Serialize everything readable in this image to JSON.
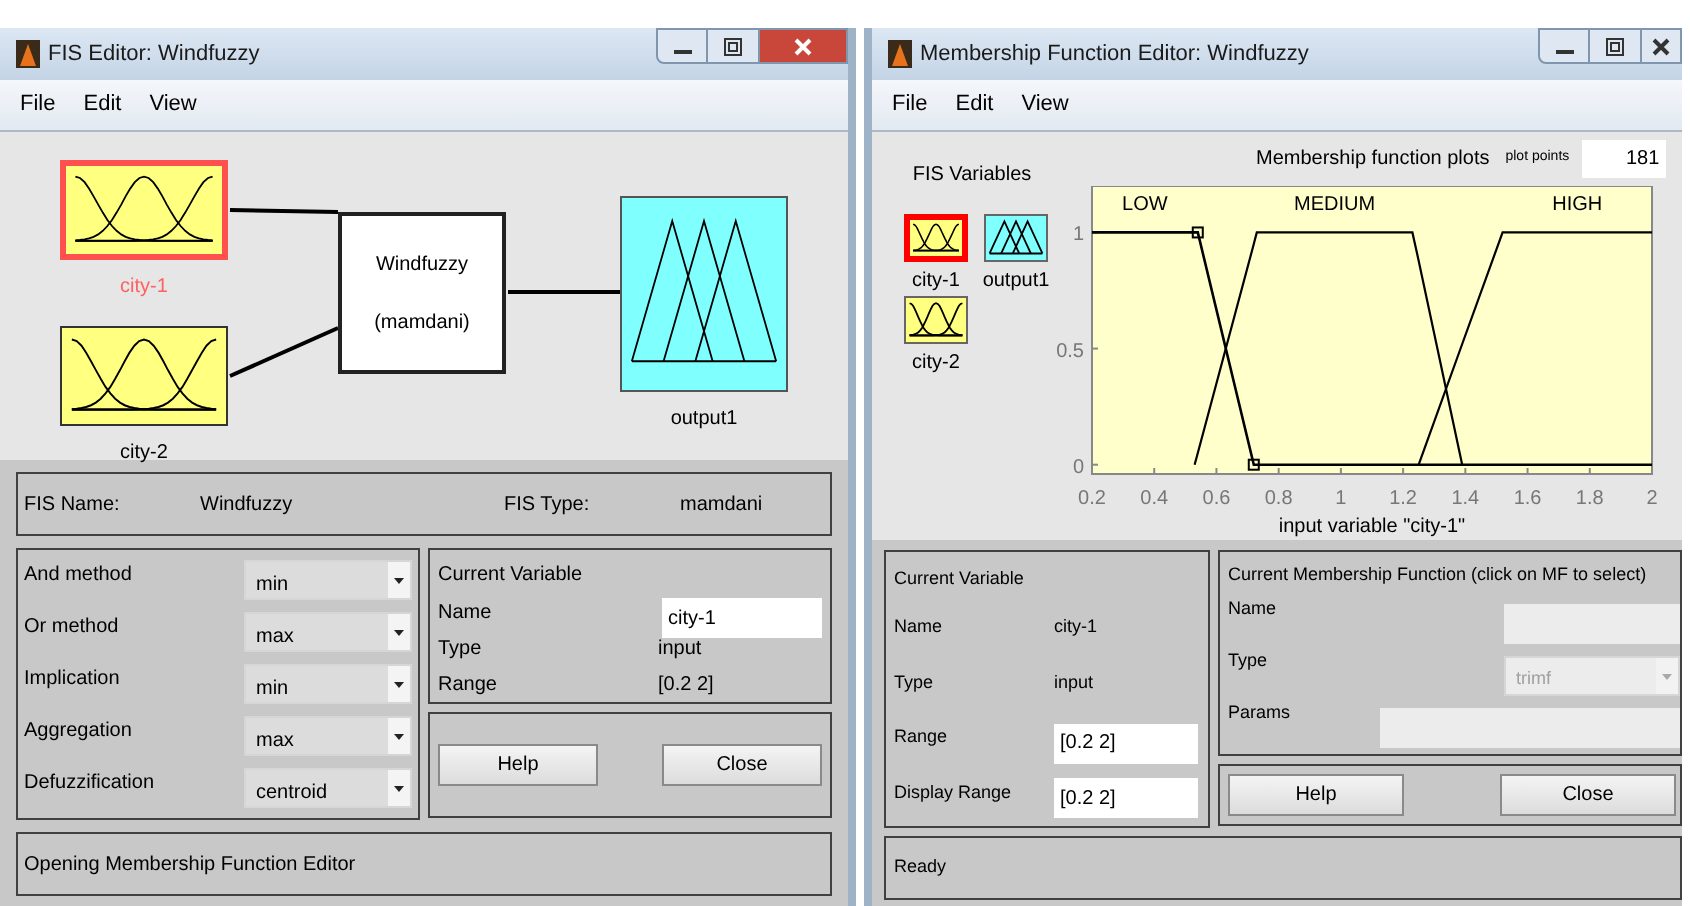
{
  "fis_editor": {
    "window": {
      "title": "FIS Editor: Windfuzzy"
    },
    "menu": [
      "File",
      "Edit",
      "View"
    ],
    "diagram": {
      "inputs": [
        {
          "label": "city-1",
          "selected": true
        },
        {
          "label": "city-2",
          "selected": false
        }
      ],
      "system": {
        "name": "Windfuzzy",
        "type": "(mamdani)"
      },
      "outputs": [
        {
          "label": "output1",
          "selected": false
        }
      ]
    },
    "fis_info": [
      {
        "label": "FIS Name:",
        "value": "Windfuzzy"
      },
      {
        "label": "FIS Type:",
        "value": "mamdani"
      }
    ],
    "methods": [
      {
        "label": "And method",
        "value": "min"
      },
      {
        "label": "Or method",
        "value": "max"
      },
      {
        "label": "Implication",
        "value": "min"
      },
      {
        "label": "Aggregation",
        "value": "max"
      },
      {
        "label": "Defuzzification",
        "value": "centroid"
      }
    ],
    "current_variable": {
      "title": "Current Variable",
      "fields": [
        {
          "label": "Name",
          "value": "city-1",
          "kind": "field"
        },
        {
          "label": "Type",
          "value": "input",
          "kind": "text"
        },
        {
          "label": "Range",
          "value": "[0.2 2]",
          "kind": "text"
        }
      ]
    },
    "buttons": [
      "Help",
      "Close"
    ],
    "status": "Opening Membership Function Editor"
  },
  "mf_editor": {
    "window": {
      "title": "Membership Function Editor: Windfuzzy"
    },
    "menu": [
      "File",
      "Edit",
      "View"
    ],
    "variables": {
      "title": "FIS Variables",
      "items": [
        {
          "label": "city-1",
          "kind": "input",
          "selected": true
        },
        {
          "label": "output1",
          "kind": "output",
          "selected": false
        },
        {
          "label": "city-2",
          "kind": "input",
          "selected": false
        }
      ]
    },
    "plot_points": {
      "label": "plot points",
      "value": "181"
    },
    "plot": {
      "chart_data": {
        "type": "line",
        "title": "Membership function plots",
        "xlabel": "input variable \"city-1\"",
        "x": [
          0.2,
          0.53,
          0.54,
          0.72,
          0.73,
          1.23,
          1.25,
          1.39,
          1.52,
          2
        ],
        "series": [
          {
            "name": "LOW",
            "color": "#000000",
            "values": [
              1,
              1,
              1,
              0,
              0,
              0,
              0,
              0,
              0,
              0
            ]
          },
          {
            "name": "MEDIUM",
            "color": "#000000",
            "values": [
              null,
              0,
              0.05,
              0.95,
              1,
              1,
              0.88,
              0,
              null,
              null
            ]
          },
          {
            "name": "HIGH",
            "color": "#000000",
            "values": [
              null,
              null,
              null,
              null,
              null,
              null,
              0,
              0.52,
              1,
              1
            ]
          }
        ],
        "xlim": [
          0.2,
          2
        ],
        "ylim": [
          -0.04,
          1.2
        ],
        "xticks": [
          0.2,
          0.4,
          0.6,
          0.8,
          1,
          1.2,
          1.4,
          1.6,
          1.8,
          2
        ],
        "yticks": [
          0,
          0.5,
          1
        ]
      },
      "curves": [
        {
          "selected": true
        },
        {
          "selected": false
        },
        {
          "selected": false
        }
      ]
    },
    "current_variable": {
      "title": "Current Variable",
      "fields": [
        {
          "label": "Name",
          "value": "city-1",
          "kind": "text"
        },
        {
          "label": "Type",
          "value": "input",
          "kind": "text"
        },
        {
          "label": "Range",
          "value": "[0.2 2]",
          "kind": "field"
        },
        {
          "label": "Display Range",
          "value": "[0.2 2]",
          "kind": "field"
        }
      ]
    },
    "current_mf": {
      "title": "Current Membership Function (click on MF to select)",
      "fields": [
        {
          "label": "Name",
          "kind": "field"
        },
        {
          "label": "Type",
          "kind": "dropdown",
          "value": "trimf",
          "disabled": true
        },
        {
          "label": "Params",
          "kind": "wide-field"
        }
      ]
    },
    "buttons": [
      "Help",
      "Close"
    ],
    "status": "Ready"
  }
}
